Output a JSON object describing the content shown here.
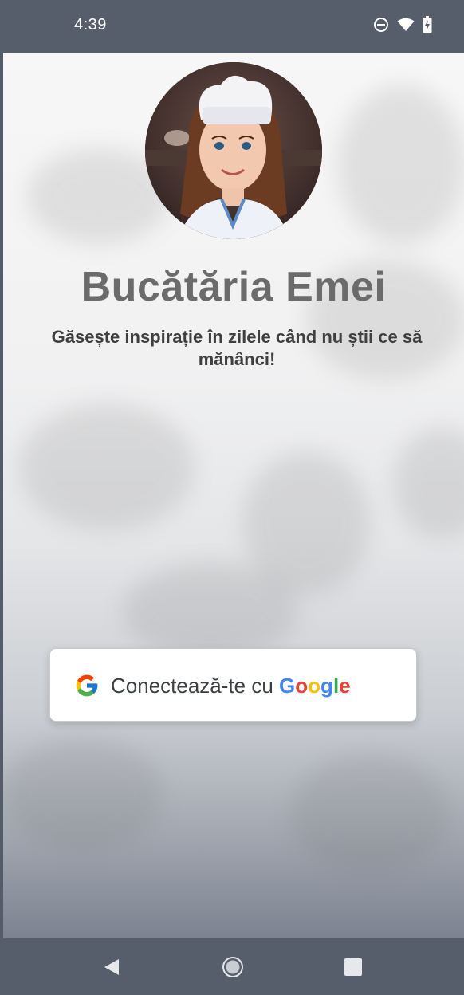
{
  "status_bar": {
    "time": "4:39",
    "icons": [
      "do-not-disturb-icon",
      "wifi-icon",
      "battery-charging-icon"
    ]
  },
  "app": {
    "title": "Bucătăria Emei",
    "tagline": "Găsește inspirație în zilele când nu știi ce să mănânci!"
  },
  "avatar": {
    "badge_icon": "vegan-leaf-icon"
  },
  "sign_in": {
    "label_prefix": "Conectează-te cu",
    "label_brand_letters": [
      "G",
      "o",
      "o",
      "g",
      "l",
      "e"
    ],
    "brand_colors": [
      "#4285F4",
      "#EA4335",
      "#FBBC05",
      "#4285F4",
      "#34A853",
      "#EA4335"
    ],
    "icon": "google-g-icon"
  },
  "nav_bar": {
    "buttons": [
      "back-icon",
      "home-icon",
      "recents-icon"
    ]
  },
  "colors": {
    "system_bar": "#565e6b",
    "title": "#6b6b6b",
    "tagline": "#3f3f3f"
  }
}
